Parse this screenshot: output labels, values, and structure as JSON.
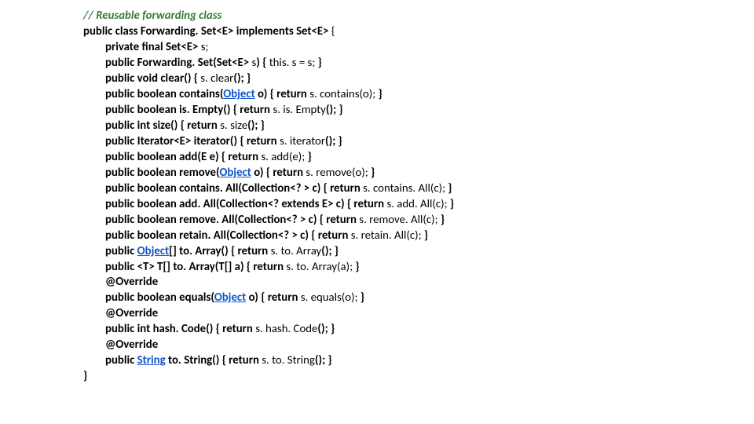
{
  "code": {
    "l01": "// Reusable forwarding class",
    "l02a": "public class ",
    "l02b": "Forwarding. Set",
    "l02c": "<E>",
    "l02d": " implements Set<E> ",
    "l02e": "{",
    "l03a": "private final Set<E> ",
    "l03b": "s",
    "l03c": ";",
    "l04a": "public ",
    "l04b": "Forwarding. Set",
    "l04c": "(Set<E> ",
    "l04d": "s",
    "l04e": ") { ",
    "l04f": "this. s = s; ",
    "l04g": "}",
    "l05a": "public void clear() { ",
    "l05b": "s. clear",
    "l05c": "(); }",
    "l06a": "public ",
    "l06b": "boolean",
    "l06c": " contains(",
    "l06d": "Object",
    "l06e": " o) { return ",
    "l06f": "s. contains(o); ",
    "l06g": "}",
    "l07a": "public ",
    "l07b": "boolean",
    "l07c": " is. Empty() { return ",
    "l07d": "s. is. Empty",
    "l07e": "(); }",
    "l08a": "public ",
    "l08b": "int",
    "l08c": " size() { return ",
    "l08d": "s. size",
    "l08e": "(); }",
    "l09a": "public Iterator<E> iterator() { return ",
    "l09b": "s. iterator",
    "l09c": "(); }",
    "l10a": "public ",
    "l10b": "boolean",
    "l10c": " add(E e) { return ",
    "l10d": "s. add(e); ",
    "l10e": "}",
    "l11a": "public ",
    "l11b": "boolean",
    "l11c": " remove(",
    "l11d": "Object",
    "l11e": " o) { return ",
    "l11f": "s. remove(o); ",
    "l11g": "}",
    "l12a": "public ",
    "l12b": "boolean",
    "l12c": " contains. All(Collection<? > c) { return ",
    "l12d": "s. contains. All(c); ",
    "l12e": "}",
    "l13a": "public ",
    "l13b": "boolean",
    "l13c": " add. All(Collection<? extends E> c) { return ",
    "l13d": "s. add. All(c); ",
    "l13e": "}",
    "l14a": "public ",
    "l14b": "boolean",
    "l14c": " remove. All(Collection<? > c) { return ",
    "l14d": "s. remove. All(c); ",
    "l14e": "}",
    "l15a": "public ",
    "l15b": "boolean",
    "l15c": " retain. All(Collection<? > c) { return ",
    "l15d": "s. retain. All(c); ",
    "l15e": "}",
    "l16a": "public ",
    "l16b": "Object",
    "l16c": "[] to. Array() { return ",
    "l16d": "s. to. Array",
    "l16e": "(); }",
    "l17a": "public <T> T[] to. Array(T[] a) { return ",
    "l17b": "s. to. Array(a); ",
    "l17c": "}",
    "l18": "@Override",
    "l19a": "public ",
    "l19b": "boolean",
    "l19c": " equals(",
    "l19d": "Object",
    "l19e": " o) { return ",
    "l19f": "s. equals(o); ",
    "l19g": "}",
    "l20": "@Override",
    "l21a": "public ",
    "l21b": "int",
    "l21c": " hash. Code() { return ",
    "l21d": "s. hash. Code",
    "l21e": "(); }",
    "l22": "@Override",
    "l23a": "public ",
    "l23b": "String",
    "l23c": " to. String() { return ",
    "l23d": "s. to. String",
    "l23e": "(); }",
    "l24": "}"
  }
}
